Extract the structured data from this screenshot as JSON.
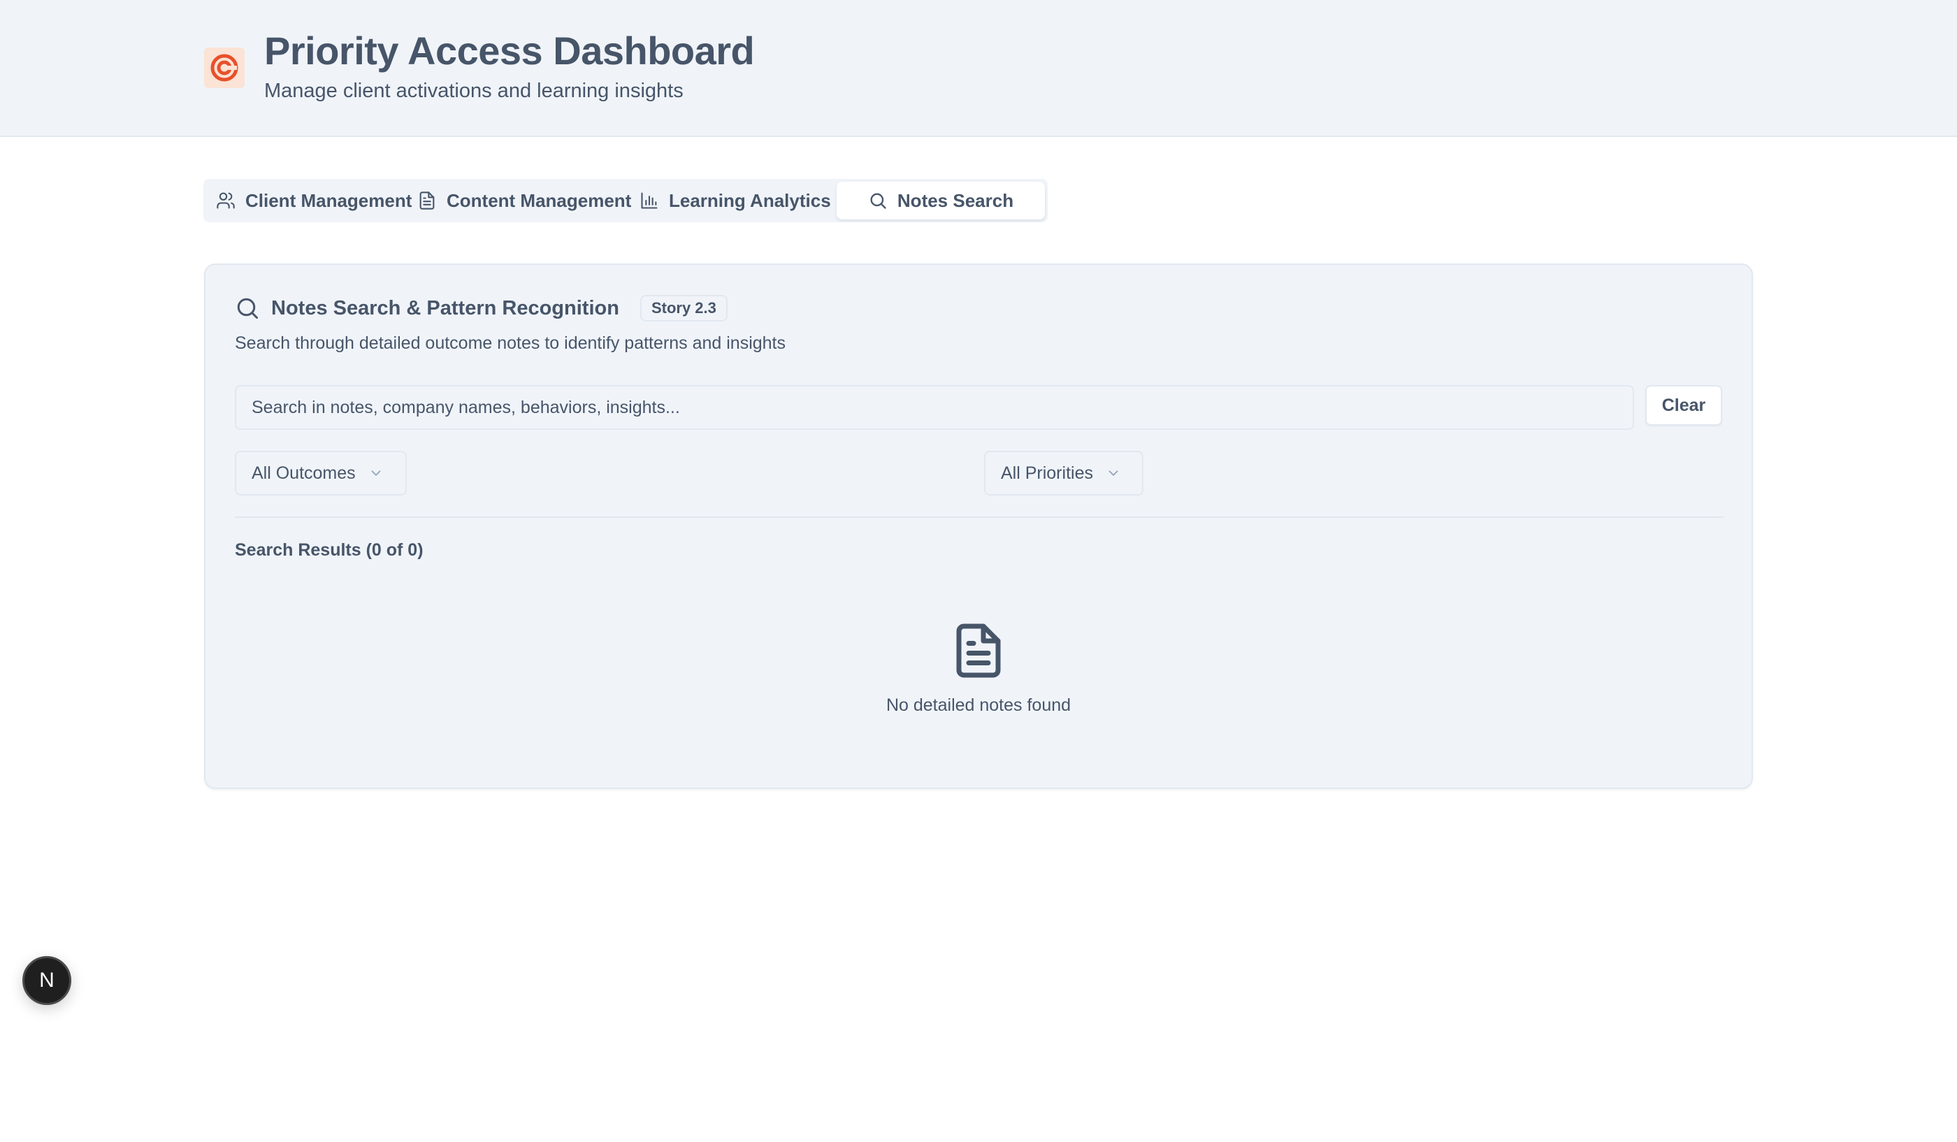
{
  "header": {
    "title": "Priority Access Dashboard",
    "subtitle": "Manage client activations and learning insights",
    "logo_icon": "target-logo-icon",
    "logo_color": "#e8502a"
  },
  "tabs": [
    {
      "label": "Client Management",
      "icon": "users-icon",
      "active": false
    },
    {
      "label": "Content Management",
      "icon": "file-text-icon",
      "active": false
    },
    {
      "label": "Learning Analytics",
      "icon": "bar-chart-icon",
      "active": false
    },
    {
      "label": "Notes Search",
      "icon": "search-icon",
      "active": true
    }
  ],
  "notes_search": {
    "title": "Notes Search & Pattern Recognition",
    "badge": "Story 2.3",
    "description": "Search through detailed outcome notes to identify patterns and insights",
    "search_placeholder": "Search in notes, company names, behaviors, insights...",
    "search_value": "",
    "clear_label": "Clear",
    "outcome_filter": "All Outcomes",
    "priority_filter": "All Priorities",
    "results_heading": "Search Results (0 of 0)",
    "empty_message": "No detailed notes found"
  },
  "fab": {
    "label": "N"
  },
  "colors": {
    "header_bg": "#f0f4f9",
    "text": "#475569",
    "border": "#e2e8f0",
    "active_tab_bg": "#ffffff"
  }
}
